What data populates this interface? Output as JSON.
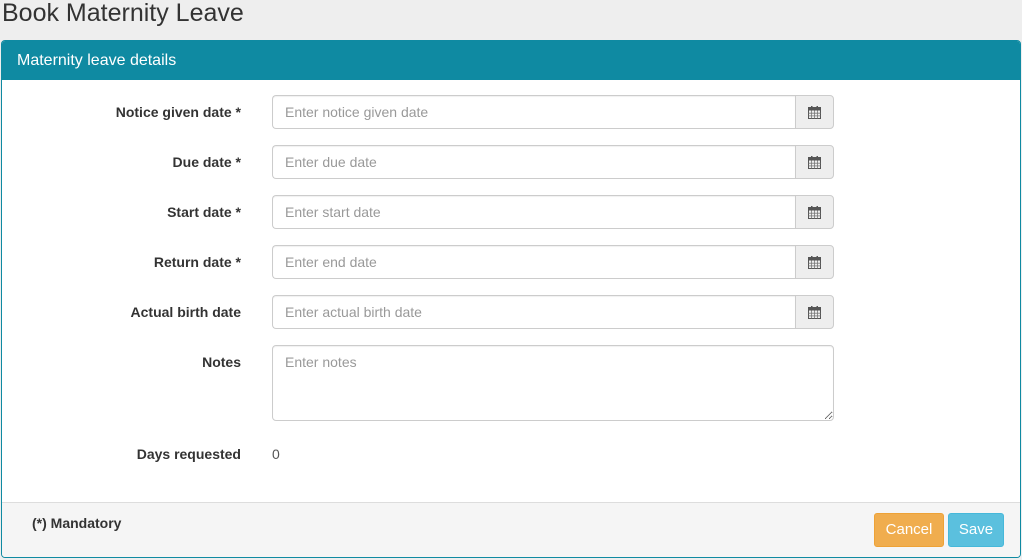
{
  "page": {
    "title": "Book Maternity Leave"
  },
  "panel": {
    "heading": "Maternity leave details"
  },
  "form": {
    "fields": [
      {
        "label": "Notice given date *",
        "placeholder": "Enter notice given date",
        "value": "",
        "icon": "calendar-icon"
      },
      {
        "label": "Due date *",
        "placeholder": "Enter due date",
        "value": "",
        "icon": "calendar-icon"
      },
      {
        "label": "Start date *",
        "placeholder": "Enter start date",
        "value": "",
        "icon": "calendar-icon"
      },
      {
        "label": "Return date *",
        "placeholder": "Enter end date",
        "value": "",
        "icon": "calendar-icon"
      },
      {
        "label": "Actual birth date",
        "placeholder": "Enter actual birth date",
        "value": "",
        "icon": "calendar-icon"
      }
    ],
    "notes": {
      "label": "Notes",
      "placeholder": "Enter notes",
      "value": ""
    },
    "days_requested": {
      "label": "Days requested",
      "value": "0"
    }
  },
  "footer": {
    "mandatory_note": "(*) Mandatory",
    "cancel_label": "Cancel",
    "save_label": "Save"
  },
  "colors": {
    "accent": "#0f8aa2",
    "cancel": "#f0ad4e",
    "save": "#5bc0de"
  }
}
